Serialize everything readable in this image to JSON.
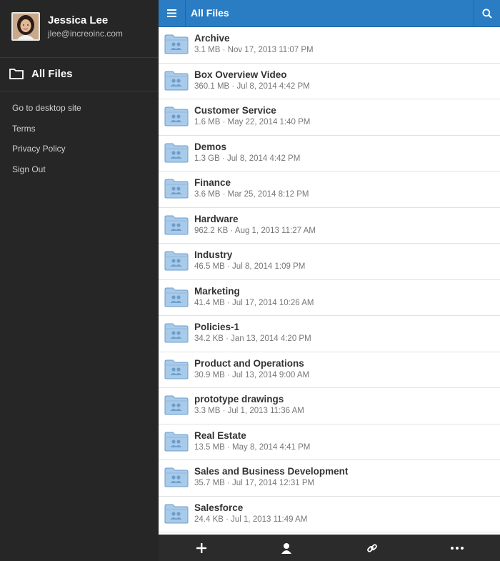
{
  "user": {
    "name": "Jessica Lee",
    "email": "jlee@increoinc.com"
  },
  "sidebar": {
    "all_files_label": "All Files",
    "menu": [
      "Go to desktop site",
      "Terms",
      "Privacy Policy",
      "Sign Out"
    ]
  },
  "header": {
    "title": "All Files"
  },
  "files": [
    {
      "name": "Archive",
      "meta": "3.1 MB · Nov 17, 2013 11:07 PM"
    },
    {
      "name": "Box Overview Video",
      "meta": "360.1 MB · Jul 8, 2014 4:42 PM"
    },
    {
      "name": "Customer Service",
      "meta": "1.6 MB · May 22, 2014 1:40 PM"
    },
    {
      "name": "Demos",
      "meta": "1.3 GB · Jul 8, 2014 4:42 PM"
    },
    {
      "name": "Finance",
      "meta": "3.6 MB · Mar 25, 2014 8:12 PM"
    },
    {
      "name": "Hardware",
      "meta": "962.2 KB · Aug 1, 2013 11:27 AM"
    },
    {
      "name": "Industry",
      "meta": "46.5 MB · Jul 8, 2014 1:09 PM"
    },
    {
      "name": "Marketing",
      "meta": "41.4 MB · Jul 17, 2014 10:26 AM"
    },
    {
      "name": "Policies-1",
      "meta": "34.2 KB · Jan 13, 2014 4:20 PM"
    },
    {
      "name": "Product and Operations",
      "meta": "30.9 MB · Jul 13, 2014 9:00 AM"
    },
    {
      "name": "prototype drawings",
      "meta": "3.3 MB · Jul 1, 2013 11:36 AM"
    },
    {
      "name": "Real Estate",
      "meta": "13.5 MB · May 8, 2014 4:41 PM"
    },
    {
      "name": "Sales and Business Development",
      "meta": "35.7 MB · Jul 17, 2014 12:31 PM"
    },
    {
      "name": "Salesforce",
      "meta": "24.4 KB · Jul 1, 2013 11:49 AM"
    }
  ],
  "icons": {
    "menu": "hamburger-icon",
    "search": "search-icon",
    "folder": "shared-folder-icon",
    "add": "plus-icon",
    "user": "user-icon",
    "link": "link-icon",
    "more": "more-icon"
  },
  "colors": {
    "header": "#2a7dc3",
    "sidebar": "#262626",
    "bottombar": "#2b2b2b",
    "folder": "#a9cbea"
  }
}
